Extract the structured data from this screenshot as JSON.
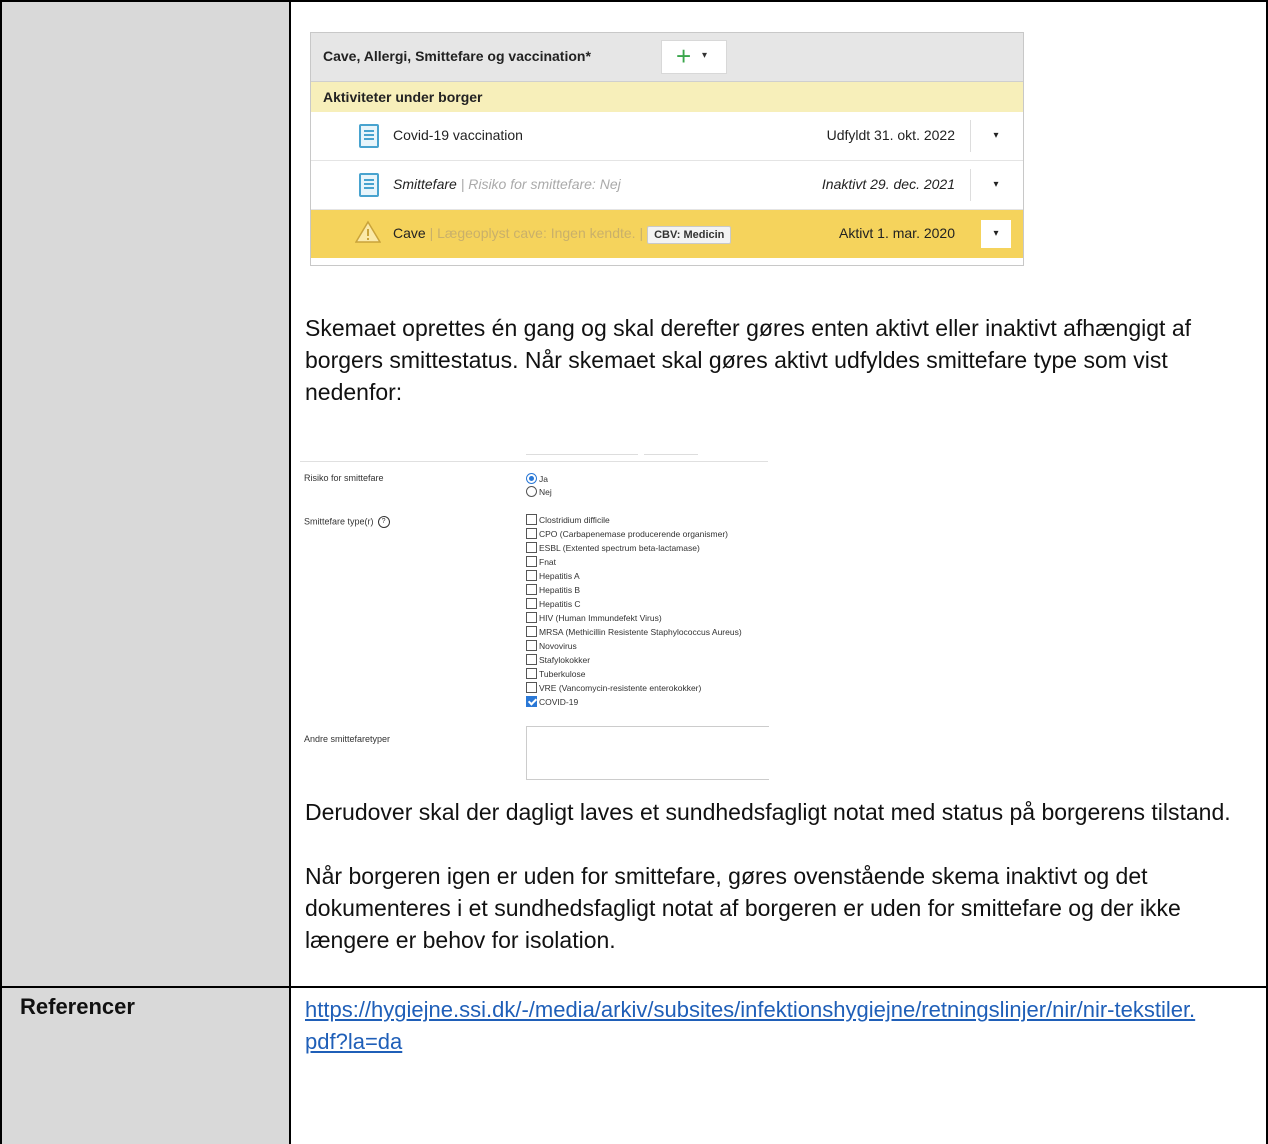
{
  "panel": {
    "title": "Cave, Allergi, Smittefare og vaccination*",
    "add_symbol": "+",
    "caret": "▾",
    "section": "Aktiviteter under borger",
    "rows": [
      {
        "name": "Covid-19 vaccination",
        "detail": "",
        "date": "Udfyldt 31. okt. 2022",
        "icon": "document-icon"
      },
      {
        "name": "Smittefare",
        "detail": " | Risiko for smittefare: Nej",
        "date": "Inaktivt 29. dec. 2021",
        "icon": "document-icon"
      },
      {
        "name": "Cave",
        "detail": " | Lægeoplyst cave: Ingen kendte. |",
        "tag": "CBV: Medicin",
        "date": "Aktivt 1. mar. 2020",
        "icon": "warning-icon"
      }
    ],
    "colors": {
      "highlight": "#f5d35c",
      "section": "#f7efba",
      "plus": "#3aa64b"
    }
  },
  "paragraph1": "Skemaet oprettes én gang og skal derefter gøres enten aktivt eller inaktivt afhængigt af borgers smittestatus. Når skemaet skal gøres aktivt udfyldes smittefare type som vist nedenfor:",
  "form": {
    "risk_label": "Risiko for smittefare",
    "risk_options": [
      {
        "label": "Ja",
        "selected": true
      },
      {
        "label": "Nej",
        "selected": false
      }
    ],
    "types_label": "Smittefare type(r)",
    "help_symbol": "?",
    "types": [
      {
        "label": "Clostridium difficile",
        "checked": false
      },
      {
        "label": "CPO (Carbapenemase producerende organismer)",
        "checked": false
      },
      {
        "label": "ESBL (Extented spectrum beta-lactamase)",
        "checked": false
      },
      {
        "label": "Fnat",
        "checked": false
      },
      {
        "label": "Hepatitis A",
        "checked": false
      },
      {
        "label": "Hepatitis B",
        "checked": false
      },
      {
        "label": "Hepatitis C",
        "checked": false
      },
      {
        "label": "HIV (Human Immundefekt Virus)",
        "checked": false
      },
      {
        "label": "MRSA (Methicillin Resistente Staphylococcus Aureus)",
        "checked": false
      },
      {
        "label": "Novovirus",
        "checked": false
      },
      {
        "label": "Stafylokokker",
        "checked": false
      },
      {
        "label": "Tuberkulose",
        "checked": false
      },
      {
        "label": "VRE (Vancomycin-resistente enterokokker)",
        "checked": false
      },
      {
        "label": "COVID-19",
        "checked": true
      }
    ],
    "other_label": "Andre smittefaretyper"
  },
  "paragraph2": "Derudover skal der dagligt laves et sundhedsfagligt notat med status på borgerens tilstand.",
  "paragraph3": "Når borgeren igen er uden for smittefare, gøres ovenstående skema inaktivt og det dokumenteres i et sundhedsfagligt notat af borgeren er uden for smittefare og der ikke længere er behov for isolation.",
  "references": {
    "label": "Referencer",
    "link": "https://hygiejne.ssi.dk/-/media/arkiv/subsites/infektionshygiejne/retningslinjer/nir/nir-tekstiler.pdf?la=da"
  }
}
